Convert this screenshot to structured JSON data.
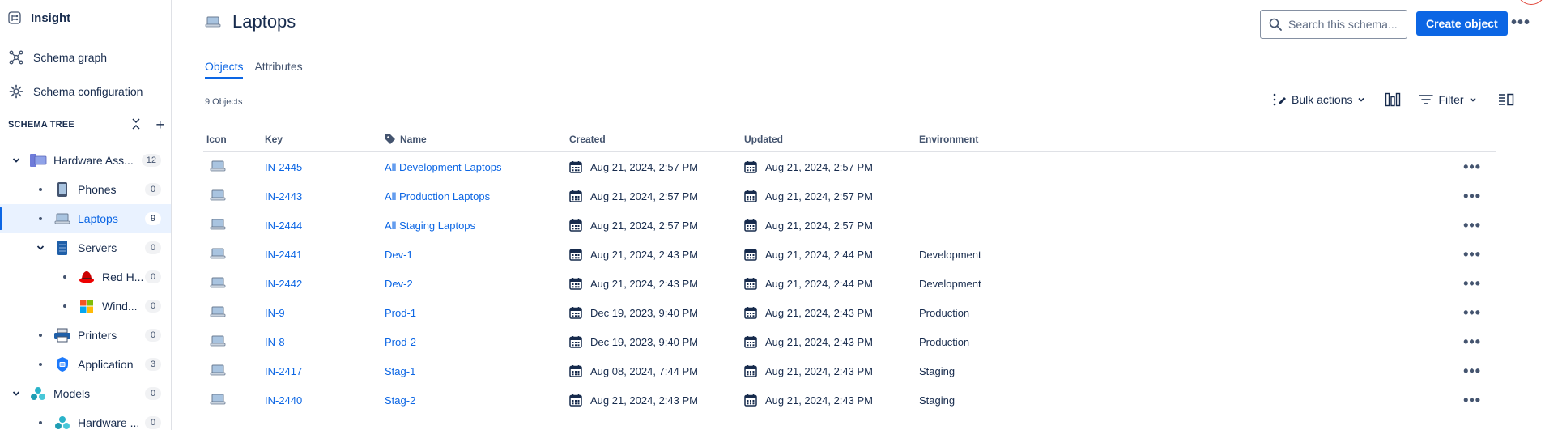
{
  "app": {
    "title": "Insight"
  },
  "sidebar": {
    "links": [
      {
        "label": "Schema graph",
        "icon": "schema-graph-icon"
      },
      {
        "label": "Schema configuration",
        "icon": "gear-icon"
      }
    ],
    "tree_title": "SCHEMA TREE",
    "tree": [
      {
        "label": "Hardware Ass...",
        "count": "12",
        "level": 0,
        "toggle": "expanded",
        "icon": "hardware-assets-icon"
      },
      {
        "label": "Phones",
        "count": "0",
        "level": 1,
        "toggle": "bullet",
        "icon": "phone-icon"
      },
      {
        "label": "Laptops",
        "count": "9",
        "level": 1,
        "toggle": "bullet",
        "icon": "laptop-icon",
        "selected": true
      },
      {
        "label": "Servers",
        "count": "0",
        "level": 1,
        "toggle": "expanded",
        "icon": "server-icon"
      },
      {
        "label": "Red H...",
        "count": "0",
        "level": 2,
        "toggle": "bullet",
        "icon": "red-hat-icon"
      },
      {
        "label": "Wind...",
        "count": "0",
        "level": 2,
        "toggle": "bullet",
        "icon": "windows-icon"
      },
      {
        "label": "Printers",
        "count": "0",
        "level": 1,
        "toggle": "bullet",
        "icon": "printer-icon"
      },
      {
        "label": "Application",
        "count": "3",
        "level": 1,
        "toggle": "bullet",
        "icon": "application-shield-icon"
      },
      {
        "label": "Models",
        "count": "0",
        "level": 0,
        "toggle": "expanded",
        "icon": "models-icon"
      },
      {
        "label": "Hardware ...",
        "count": "0",
        "level": 1,
        "toggle": "bullet",
        "icon": "models-icon"
      }
    ]
  },
  "header": {
    "title": "Laptops",
    "search_placeholder": "Search this schema...",
    "create_label": "Create object",
    "more_label": "•••"
  },
  "tabs": [
    {
      "label": "Objects",
      "active": true
    },
    {
      "label": "Attributes",
      "active": false
    }
  ],
  "object_count": "9 Objects",
  "toolbar": {
    "bulk_actions": "Bulk actions",
    "filter": "Filter"
  },
  "table": {
    "columns": {
      "icon": "Icon",
      "key": "Key",
      "name": "Name",
      "created": "Created",
      "updated": "Updated",
      "environment": "Environment"
    },
    "rows": [
      {
        "key": "IN-2445",
        "name": "All Development Laptops",
        "created": "Aug 21, 2024, 2:57 PM",
        "updated": "Aug 21, 2024, 2:57 PM",
        "environment": ""
      },
      {
        "key": "IN-2443",
        "name": "All Production Laptops",
        "created": "Aug 21, 2024, 2:57 PM",
        "updated": "Aug 21, 2024, 2:57 PM",
        "environment": ""
      },
      {
        "key": "IN-2444",
        "name": "All Staging Laptops",
        "created": "Aug 21, 2024, 2:57 PM",
        "updated": "Aug 21, 2024, 2:57 PM",
        "environment": ""
      },
      {
        "key": "IN-2441",
        "name": "Dev-1",
        "created": "Aug 21, 2024, 2:43 PM",
        "updated": "Aug 21, 2024, 2:44 PM",
        "environment": "Development"
      },
      {
        "key": "IN-2442",
        "name": "Dev-2",
        "created": "Aug 21, 2024, 2:43 PM",
        "updated": "Aug 21, 2024, 2:44 PM",
        "environment": "Development"
      },
      {
        "key": "IN-9",
        "name": "Prod-1",
        "created": "Dec 19, 2023, 9:40 PM",
        "updated": "Aug 21, 2024, 2:43 PM",
        "environment": "Production"
      },
      {
        "key": "IN-8",
        "name": "Prod-2",
        "created": "Dec 19, 2023, 9:40 PM",
        "updated": "Aug 21, 2024, 2:43 PM",
        "environment": "Production"
      },
      {
        "key": "IN-2417",
        "name": "Stag-1",
        "created": "Aug 08, 2024, 7:44 PM",
        "updated": "Aug 21, 2024, 2:43 PM",
        "environment": "Staging"
      },
      {
        "key": "IN-2440",
        "name": "Stag-2",
        "created": "Aug 21, 2024, 2:43 PM",
        "updated": "Aug 21, 2024, 2:43 PM",
        "environment": "Staging"
      }
    ]
  },
  "colors": {
    "accent": "#0c66e4",
    "text": "#172b4d",
    "subtle": "#44546f",
    "border": "#dfe1e6"
  }
}
